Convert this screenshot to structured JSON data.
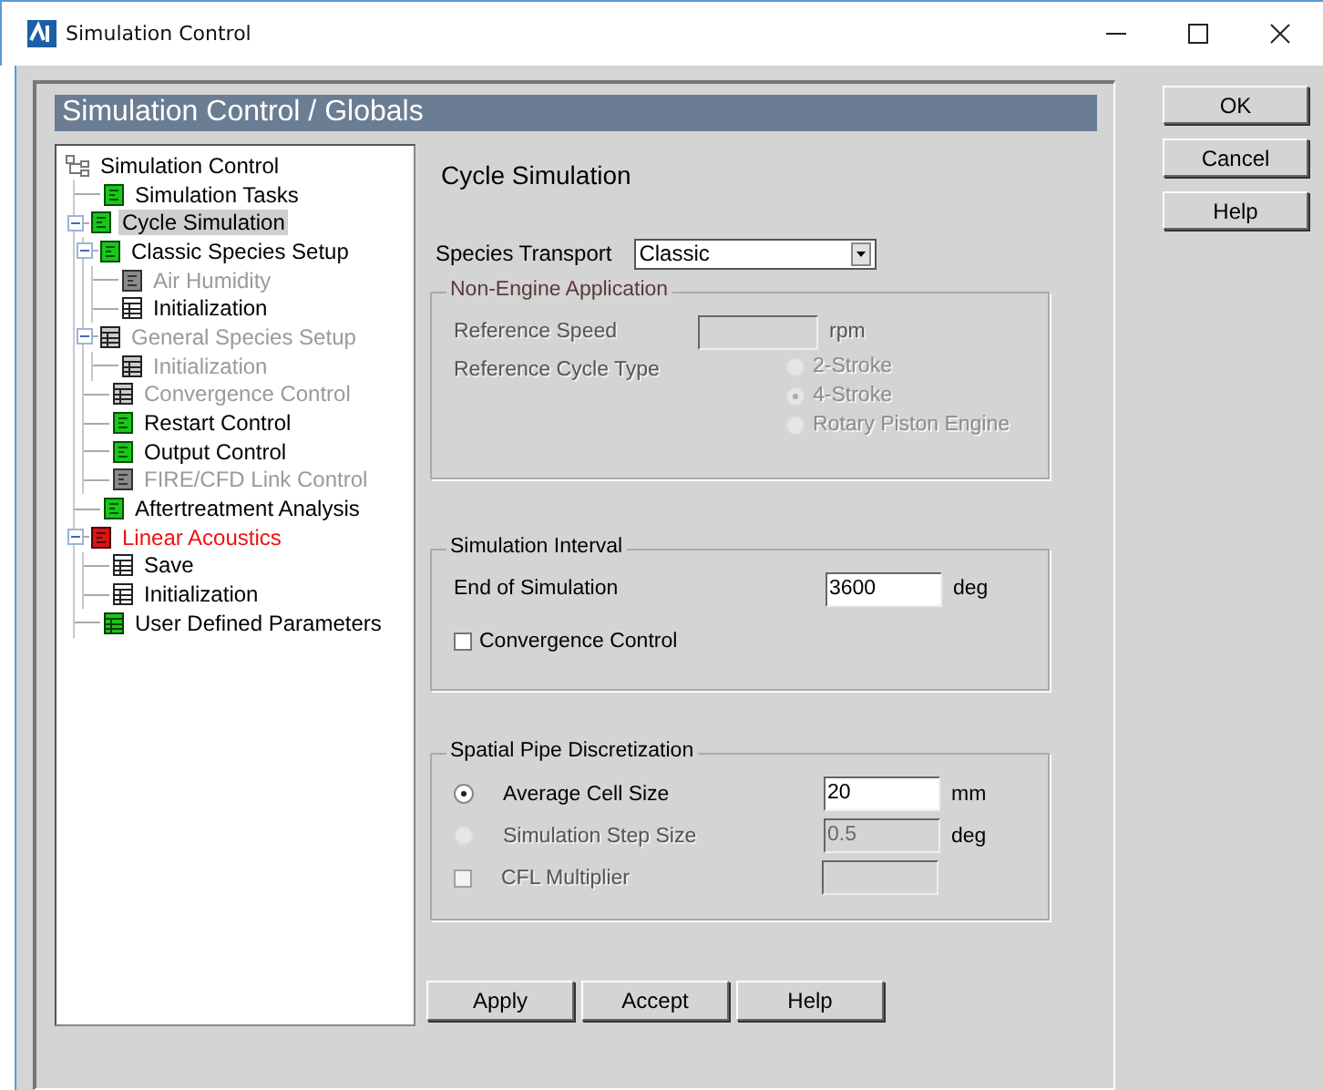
{
  "window": {
    "title": "Simulation Control"
  },
  "header": "Simulation Control / Globals",
  "tree": {
    "label": "Simulation Control",
    "kind": "root",
    "disabled": false,
    "error": false,
    "selected": false,
    "children": [
      {
        "label": "Simulation Tasks",
        "kind": "green",
        "disabled": false,
        "error": false,
        "selected": false
      },
      {
        "label": "Cycle Simulation",
        "kind": "green",
        "disabled": false,
        "error": false,
        "selected": true,
        "expanded": true,
        "children": [
          {
            "label": "Classic Species Setup",
            "kind": "green",
            "disabled": false,
            "error": false,
            "selected": false,
            "expanded": true,
            "children": [
              {
                "label": "Air Humidity",
                "kind": "gray",
                "disabled": true,
                "error": false,
                "selected": false
              },
              {
                "label": "Initialization",
                "kind": "table",
                "disabled": false,
                "error": false,
                "selected": false
              }
            ]
          },
          {
            "label": "General Species Setup",
            "kind": "table-dark",
            "disabled": true,
            "error": false,
            "selected": false,
            "expanded": true,
            "children": [
              {
                "label": "Initialization",
                "kind": "table-dark",
                "disabled": true,
                "error": false,
                "selected": false
              }
            ]
          },
          {
            "label": "Convergence Control",
            "kind": "table-dark",
            "disabled": true,
            "error": false,
            "selected": false
          },
          {
            "label": "Restart Control",
            "kind": "green",
            "disabled": false,
            "error": false,
            "selected": false
          },
          {
            "label": "Output Control",
            "kind": "green",
            "disabled": false,
            "error": false,
            "selected": false
          },
          {
            "label": "FIRE/CFD Link Control",
            "kind": "gray",
            "disabled": true,
            "error": false,
            "selected": false
          }
        ]
      },
      {
        "label": "Aftertreatment Analysis",
        "kind": "green",
        "disabled": false,
        "error": false,
        "selected": false
      },
      {
        "label": "Linear Acoustics",
        "kind": "red",
        "disabled": false,
        "error": true,
        "selected": false,
        "expanded": true,
        "children": [
          {
            "label": "Save",
            "kind": "table",
            "disabled": false,
            "error": false,
            "selected": false
          },
          {
            "label": "Initialization",
            "kind": "table",
            "disabled": false,
            "error": false,
            "selected": false
          }
        ]
      },
      {
        "label": "User Defined Parameters",
        "kind": "table-green",
        "disabled": false,
        "error": false,
        "selected": false
      }
    ]
  },
  "page_title": "Cycle Simulation",
  "species_transport": {
    "label": "Species Transport",
    "value": "Classic"
  },
  "non_engine": {
    "title": "Non-Engine Application",
    "disabled": true,
    "speed_label": "Reference Speed",
    "speed_unit": "rpm",
    "cycle_label": "Reference Cycle Type",
    "options": [
      {
        "label": "2-Stroke",
        "selected": false
      },
      {
        "label": "4-Stroke",
        "selected": true
      },
      {
        "label": "Rotary Piston Engine",
        "selected": false
      }
    ]
  },
  "simulation_interval": {
    "title": "Simulation Interval",
    "end_label": "End of Simulation",
    "end_value": "3600",
    "end_unit": "deg",
    "convergence_label": "Convergence Control",
    "convergence_checked": false
  },
  "discretization": {
    "title": "Spatial Pipe Discretization",
    "rows": [
      {
        "kind": "radio",
        "label": "Average Cell Size",
        "selected": true,
        "disabled": false,
        "value": "20",
        "unit": "mm"
      },
      {
        "kind": "radio",
        "label": "Simulation Step Size",
        "selected": false,
        "disabled": true,
        "value": "0.5",
        "unit": "deg"
      },
      {
        "kind": "checkbox",
        "label": "CFL Multiplier",
        "checked": false,
        "disabled": true
      }
    ]
  },
  "bottom_buttons": [
    "Apply",
    "Accept",
    "Help"
  ],
  "side_buttons": [
    "OK",
    "Cancel",
    "Help"
  ]
}
